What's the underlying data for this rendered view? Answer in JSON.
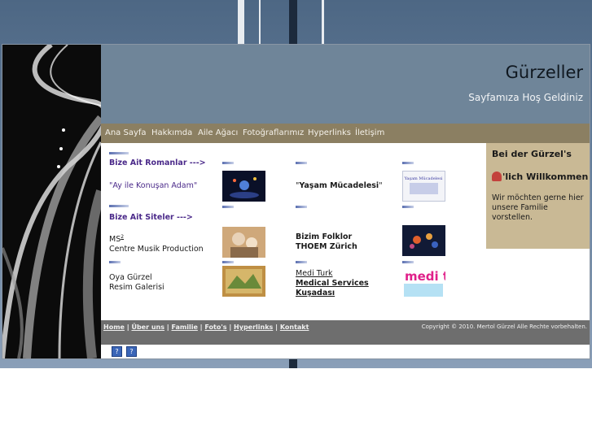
{
  "header": {
    "title": "Gürzeller",
    "subtitle": "Sayfamıza Hoş Geldiniz"
  },
  "nav": {
    "items": [
      "Ana Sayfa",
      "Hakkımda",
      "Aile Ağacı",
      "Fotoğraflarımız",
      "Hyperlinks",
      "İletişim"
    ]
  },
  "sidebar": {
    "heading1": "Bei der Gürzel's",
    "heading2": "'lich Willkommen",
    "text": "Wir möchten gerne hier unsere Familie vorstellen."
  },
  "content": {
    "section1_title": "Bize Ait Romanlar --->",
    "novel1": "\"Ay ile Konuşan Adam\"",
    "novel2_q1": "\"",
    "novel2_title": "Yaşam Mücadelesi",
    "novel2_q2": "\"",
    "section2_title": "Bize Ait Siteler --->",
    "site1_line1": "MS",
    "site1_sup": "2",
    "site1_line2": "Centre Musik Production",
    "site2_line1": "Bizim Folklor",
    "site2_line2": "THOEM Zürich",
    "site3_line1": "Oya Gürzel",
    "site3_line2": "Resim Galerisi",
    "site4_line1": "Medi Turk",
    "site4_line2": "Medical Services",
    "site4_line3": "Kuşadası",
    "book_cover_text": "Yaşam Mücadelesi",
    "meditu_logo_text": "medi turk"
  },
  "footer": {
    "links": [
      "Home",
      "Über uns",
      "Familie",
      "Foto's",
      "Hyperlinks",
      "Kontakt"
    ],
    "separator": " | ",
    "copyright": "Copyright © 2010. Mertol Gürzel Alle Rechte vorbehalten."
  },
  "bottom_icons": [
    "help-icon",
    "help-icon"
  ],
  "colors": {
    "header_bg": "#6f8599",
    "nav_bg": "#8b7f62",
    "sidebar_bg": "#c9b995",
    "footer_bg": "#6e6e6e",
    "link_purple": "#4b2a8a"
  }
}
